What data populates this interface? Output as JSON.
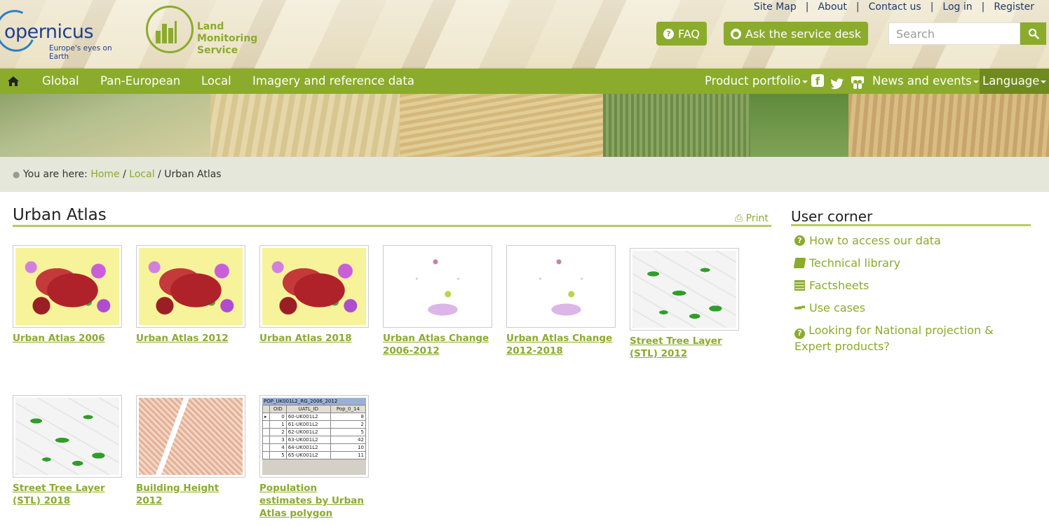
{
  "header": {
    "copernicus_logo_word": "opernicus",
    "copernicus_tagline": "Europe's eyes on Earth",
    "lms_logo_line1": "Land Monitoring",
    "lms_logo_line2": "Service",
    "top_links": [
      "Site Map",
      "About",
      "Contact us",
      "Log in",
      "Register"
    ],
    "separator": "|",
    "faq_label": "FAQ",
    "service_desk_label": "Ask the service desk",
    "search_placeholder": "Search"
  },
  "nav": {
    "items": [
      "Global",
      "Pan-European",
      "Local",
      "Imagery and reference data"
    ],
    "product_portfolio": "Product portfolio",
    "news": "News and events",
    "language": "Language"
  },
  "breadcrumb": {
    "prefix": "You are here:",
    "home": "Home",
    "local": "Local",
    "current": "Urban Atlas",
    "sep": "/"
  },
  "main": {
    "title": "Urban Atlas",
    "print_label": "Print",
    "products": [
      {
        "label": "Urban Atlas 2006",
        "thumb": "urban-atlas-map"
      },
      {
        "label": "Urban Atlas 2012",
        "thumb": "urban-atlas-map"
      },
      {
        "label": "Urban Atlas 2018",
        "thumb": "urban-atlas-map"
      },
      {
        "label": "Urban Atlas Change 2006-2012",
        "thumb": "change-map"
      },
      {
        "label": "Urban Atlas Change 2012-2018",
        "thumb": "change-map"
      },
      {
        "label": "Street Tree Layer (STL) 2012",
        "thumb": "street-tree-map"
      },
      {
        "label": "Street Tree Layer (STL) 2018",
        "thumb": "street-tree-map"
      },
      {
        "label": "Building Height 2012",
        "thumb": "building-height-map"
      },
      {
        "label": "Population estimates by Urban Atlas polygon",
        "thumb": "attribute-table"
      }
    ],
    "table_thumb": {
      "caption": "POP_UK001L2_RG_2006_2012",
      "headers": [
        "OID",
        "UATL_ID",
        "Pop_0_14"
      ],
      "rows": [
        [
          "0",
          "60-UK001L2",
          "8"
        ],
        [
          "1",
          "61-UK001L2",
          "2"
        ],
        [
          "2",
          "62-UK001L2",
          "5"
        ],
        [
          "3",
          "63-UK001L2",
          "42"
        ],
        [
          "4",
          "64-UK001L2",
          "10"
        ],
        [
          "5",
          "65-UK001L2",
          "11"
        ]
      ]
    }
  },
  "sidebar": {
    "title": "User corner",
    "items": [
      {
        "label": "How to access our data",
        "icon": "question-circle-icon"
      },
      {
        "label": "Technical library",
        "icon": "book-icon"
      },
      {
        "label": "Factsheets",
        "icon": "newspaper-icon"
      },
      {
        "label": "Use cases",
        "icon": "satellite-icon"
      },
      {
        "label": "Looking for National projection & Expert products?",
        "icon": "question-circle-icon"
      }
    ]
  },
  "colors": {
    "accent": "#8bab2c",
    "accent_dark": "#6f8a1f",
    "crumb_bg": "#e5e7da",
    "brand_blue": "#1f3f8f"
  }
}
